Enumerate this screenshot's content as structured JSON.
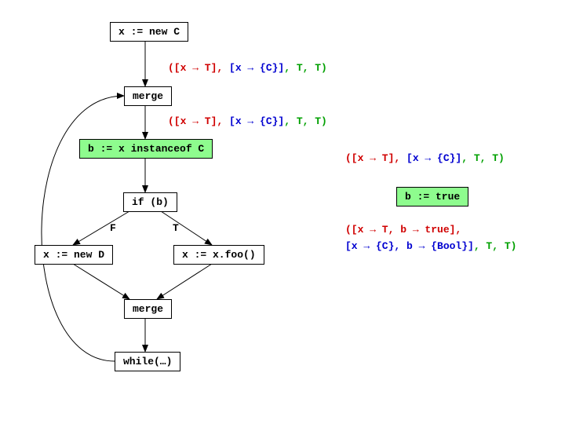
{
  "nodes": {
    "n1": "x := new C",
    "n2": "merge",
    "n3": "b := x instanceof C",
    "n4": "if (b)",
    "n5": "x := new D",
    "n6": "x := x.foo()",
    "n7": "merge",
    "n8": "while(…)",
    "n9": "b := true"
  },
  "branch": {
    "F": "F",
    "T": "T"
  },
  "annotations": {
    "a1_pre": "([x → T], ",
    "a1_mid": "[x → {C}]",
    "a1_post": ", T, T)",
    "a2_pre": "([x → T], ",
    "a2_mid": "[x → {C}]",
    "a2_post": ", T, T)",
    "a3_pre": "([x → T], ",
    "a3_mid": "[x → {C}]",
    "a3_post": ", T, T)",
    "a4_l1_pre": "([x → T,   b → true], ",
    "a4_l2_mid": " [x → {C}, b → {Bool}]",
    "a4_l2_post": ", T, T)"
  }
}
